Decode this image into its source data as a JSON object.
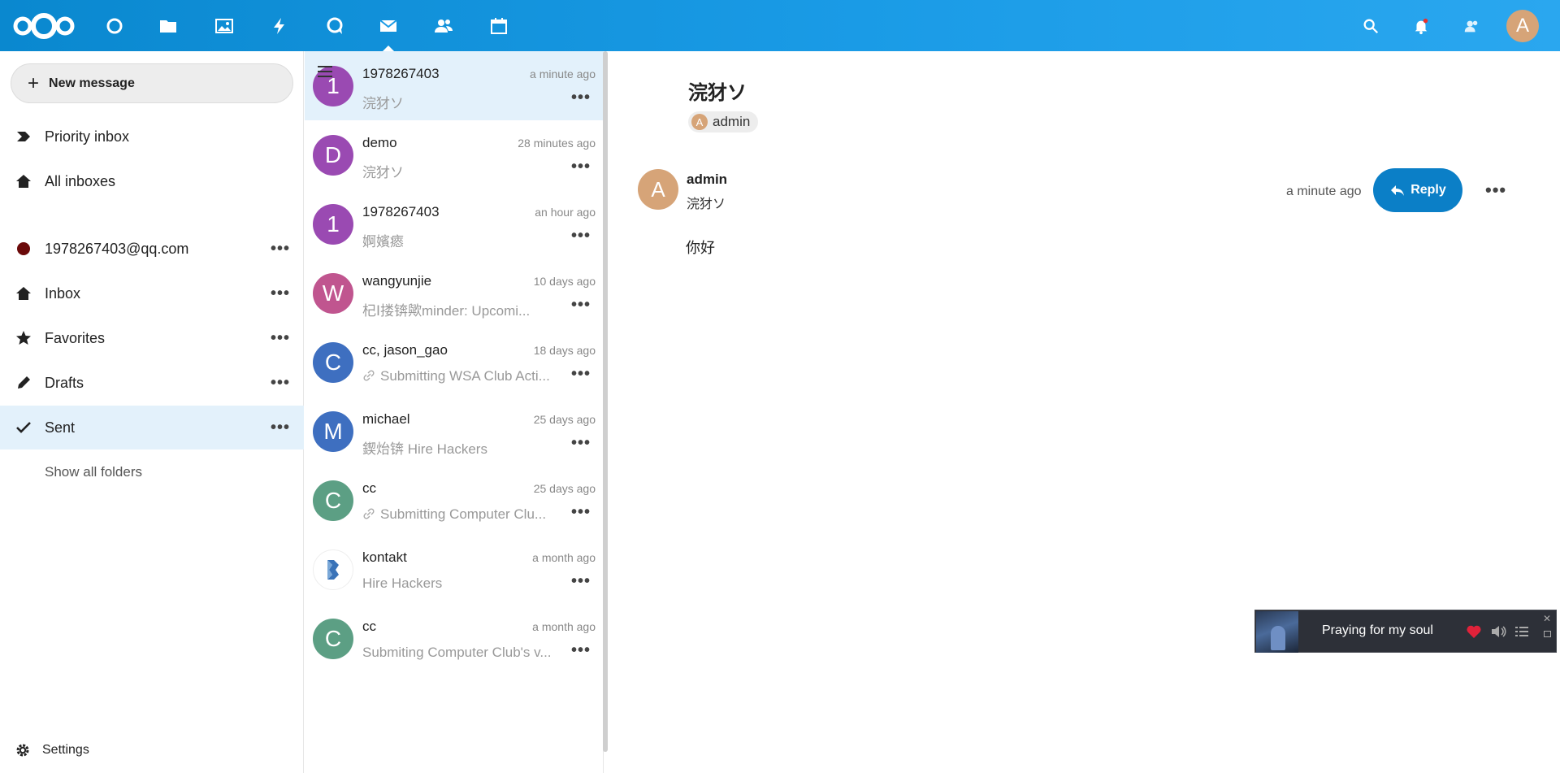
{
  "header": {
    "apps": [
      "dashboard",
      "files",
      "photos",
      "activity",
      "talk",
      "mail",
      "contacts",
      "calendar"
    ],
    "active_app": "mail",
    "user_initial": "A"
  },
  "nav": {
    "new_message": "New message",
    "items": [
      {
        "label": "Priority inbox",
        "icon": "priority-icon"
      },
      {
        "label": "All inboxes",
        "icon": "home-icon"
      },
      {
        "label": "1978267403@qq.com",
        "icon": "account-color-dot"
      },
      {
        "label": "Inbox",
        "icon": "home-icon"
      },
      {
        "label": "Favorites",
        "icon": "star-icon"
      },
      {
        "label": "Drafts",
        "icon": "pencil-icon"
      },
      {
        "label": "Sent",
        "icon": "check-icon"
      }
    ],
    "show_all": "Show all folders",
    "settings": "Settings",
    "account_color": "#6b0a0a"
  },
  "messages": [
    {
      "initial": "1",
      "from": "1978267403",
      "time": "a minute ago",
      "subject": "浣犲ソ",
      "color": "#9a4ab2"
    },
    {
      "initial": "D",
      "from": "demo",
      "time": "28 minutes ago",
      "subject": "浣犲ソ",
      "color": "#9a4ab2"
    },
    {
      "initial": "1",
      "from": "1978267403",
      "time": "an hour ago",
      "subject": "婀嬪瘱",
      "color": "#9a4ab2"
    },
    {
      "initial": "W",
      "from": "wangyunjie",
      "time": "10 days ago",
      "subject": "杞Ⅰ搂锛歟minder: Upcomi...",
      "color": "#c0558f"
    },
    {
      "initial": "C",
      "from": "cc, jason_gao",
      "time": "18 days ago",
      "subject": "Submitting WSA Club Acti...",
      "color": "#3e6fc0"
    },
    {
      "initial": "M",
      "from": "michael",
      "time": "25 days ago",
      "subject": "鍥炲锛 Hire Hackers",
      "color": "#3e6fc0"
    },
    {
      "initial": "C",
      "from": "cc",
      "time": "25 days ago",
      "subject": "Submitting Computer Clu...",
      "color": "#5c9f84"
    },
    {
      "initial": "",
      "from": "kontakt",
      "time": "a month ago",
      "subject": "Hire Hackers",
      "color": "#ffffff"
    },
    {
      "initial": "C",
      "from": "cc",
      "time": "a month ago",
      "subject": "Submiting Computer Club's v...",
      "color": "#5c9f84"
    }
  ],
  "reader": {
    "subject": "浣犲ソ",
    "recipient": "admin",
    "recipient_initial": "A",
    "sender_initial": "A",
    "sender": "admin",
    "sender_subject": "浣犲ソ",
    "time": "a minute ago",
    "reply": "Reply",
    "body": "你好"
  },
  "player": {
    "title": "Praying for my soul",
    "heart_color": "#e0223a"
  }
}
